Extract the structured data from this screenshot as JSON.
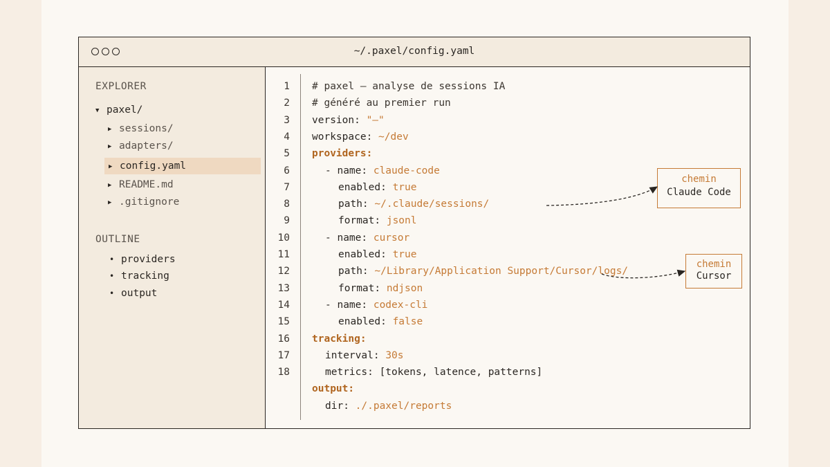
{
  "window": {
    "title": "~/.paxel/config.yaml"
  },
  "sidebar": {
    "explorer_title": "EXPLORER",
    "tree": [
      {
        "label": "paxel/",
        "kind": "folder-open",
        "level": 0
      },
      {
        "label": "sessions/",
        "kind": "folder",
        "level": 1
      },
      {
        "label": "adapters/",
        "kind": "folder",
        "level": 1
      },
      {
        "label": "config.yaml",
        "kind": "file",
        "level": 1,
        "selected": true
      },
      {
        "label": "README.md",
        "kind": "file",
        "level": 1
      },
      {
        "label": ".gitignore",
        "kind": "file",
        "level": 1
      }
    ],
    "outline_title": "OUTLINE",
    "outline": [
      "providers",
      "tracking",
      "output"
    ]
  },
  "editor": {
    "line_numbers": [
      "1",
      "2",
      "3",
      "4",
      "5",
      "6",
      "7",
      "8",
      "9",
      "10",
      "11",
      "12",
      "13",
      "14",
      "15",
      "16",
      "17",
      "18"
    ],
    "lines": [
      {
        "indent": 0,
        "comment": "# paxel — analyse de sessions IA"
      },
      {
        "indent": 0,
        "comment": "# généré au premier run"
      },
      {
        "indent": 0,
        "key": "version: ",
        "value": "\"—\""
      },
      {
        "indent": 0,
        "key": "workspace: ",
        "value": "~/dev"
      },
      {
        "indent": 0,
        "section": "providers:"
      },
      {
        "indent": 1,
        "key": "- name: ",
        "value": "claude-code"
      },
      {
        "indent": 2,
        "key": "enabled: ",
        "value": "true"
      },
      {
        "indent": 2,
        "key": "path: ",
        "value": "~/.claude/sessions/"
      },
      {
        "indent": 2,
        "key": "format: ",
        "value": "jsonl"
      },
      {
        "indent": 1,
        "key": "- name: ",
        "value": "cursor"
      },
      {
        "indent": 2,
        "key": "enabled: ",
        "value": "true"
      },
      {
        "indent": 2,
        "key": "path: ",
        "value": "~/Library/Application Support/Cursor/logs/"
      },
      {
        "indent": 2,
        "key": "format: ",
        "value": "ndjson"
      },
      {
        "indent": 1,
        "key": "- name: ",
        "value": "codex-cli"
      },
      {
        "indent": 2,
        "key": "enabled: ",
        "value": "false"
      },
      {
        "indent": 0,
        "section": "tracking:"
      },
      {
        "indent": 1,
        "key": "interval: ",
        "value": "30s"
      },
      {
        "indent": 1,
        "key": "metrics: [tokens, latence, patterns]"
      },
      {
        "indent": 0,
        "section": "output:"
      },
      {
        "indent": 1,
        "key": "dir: ",
        "value": "./.paxel/reports"
      }
    ]
  },
  "callouts": [
    {
      "line1": "chemin",
      "line2": "Claude Code"
    },
    {
      "line1": "chemin",
      "line2": "Cursor"
    }
  ],
  "colors": {
    "accent": "#c57a35",
    "section": "#b0651f",
    "selection": "#efd9c1",
    "panel": "#f3ebdf"
  }
}
